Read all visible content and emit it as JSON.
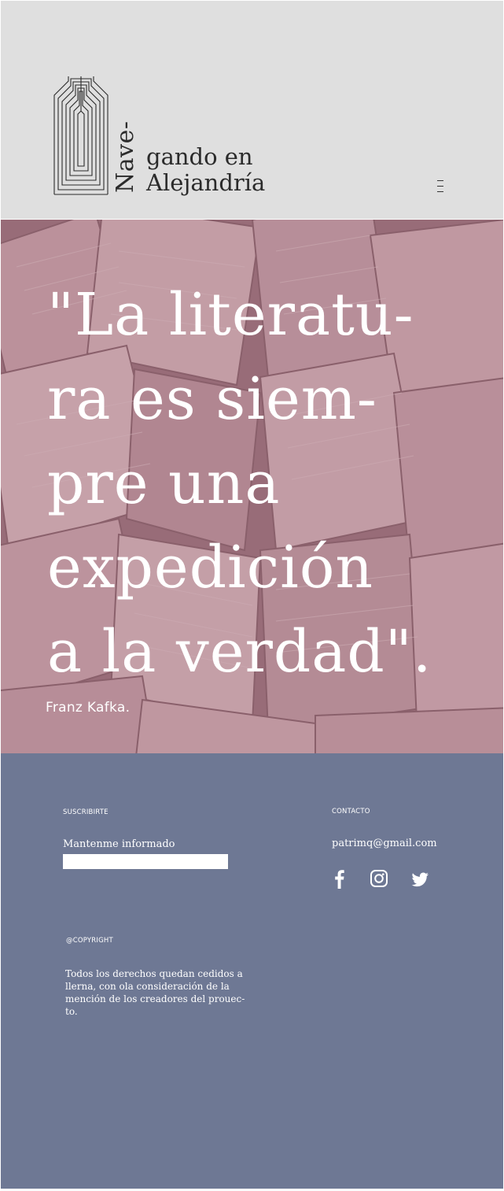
{
  "header": {
    "logo_vertical": "Nave-",
    "logo_line1": "gando en",
    "logo_line2": "Alejandría",
    "menu_icon": "hamburger-menu-icon"
  },
  "hero": {
    "quote": "\"La literatu-\nra es siem-\npre una\nexpedición\na la verdad\".",
    "author": "Franz Kafka.",
    "overlay_color": "#b0808c"
  },
  "footer": {
    "background_color": "#6e7894",
    "subscribe": {
      "label": "SUSCRIBIRTE",
      "text": "Mantenme informado",
      "input_value": ""
    },
    "contact": {
      "label": "CONTACTO",
      "email": "patrimq@gmail.com",
      "social": [
        "facebook-icon",
        "instagram-icon",
        "twitter-icon"
      ]
    },
    "copyright": {
      "label": "@COPYRIGHT",
      "text": "Todos los derechos quedan cedidos a llerna, con ola consideración de la mención de los creadores del prouec-to."
    }
  }
}
